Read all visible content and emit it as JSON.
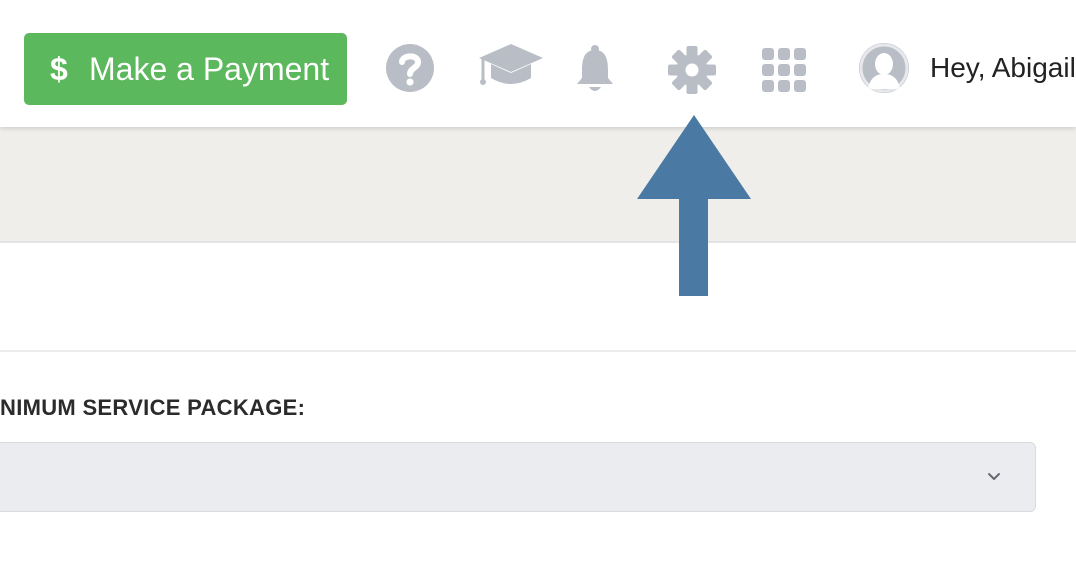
{
  "header": {
    "payment_button": {
      "icon_text": "$",
      "label": "Make a Payment",
      "color": "#5cb85c"
    },
    "icons": [
      {
        "name": "help-icon"
      },
      {
        "name": "graduation-cap-icon"
      },
      {
        "name": "bell-icon"
      },
      {
        "name": "gear-icon"
      },
      {
        "name": "app-grid-icon"
      }
    ],
    "icon_color": "#b9bec6",
    "user": {
      "avatar": "user-avatar-icon",
      "greeting": "Hey, Abigail"
    }
  },
  "form": {
    "field_label": "NIMUM SERVICE PACKAGE:",
    "select": {
      "value": "",
      "dropdown_icon": "chevron-down-icon"
    }
  },
  "annotation": {
    "type": "arrow-up-icon",
    "color": "#4a7aa3"
  }
}
